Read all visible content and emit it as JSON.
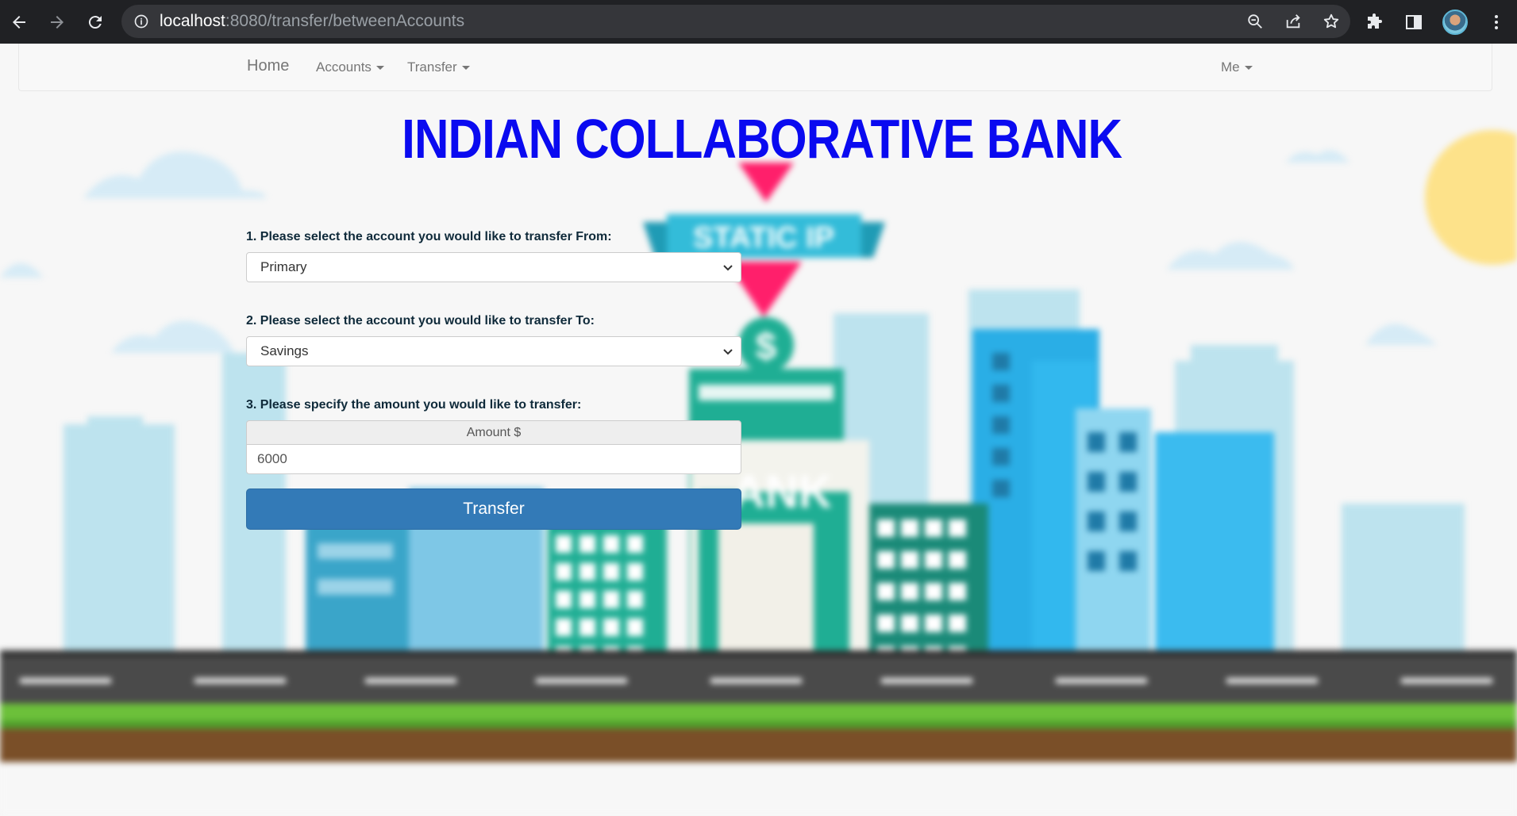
{
  "browser": {
    "url_host": "localhost",
    "url_rest": ":8080/transfer/betweenAccounts"
  },
  "navbar": {
    "home": "Home",
    "accounts": "Accounts",
    "transfer": "Transfer",
    "me": "Me"
  },
  "page_title": "INDIAN COLLABORATIVE BANK",
  "scene": {
    "sign_text": "STATIC IP",
    "dollar": "$",
    "bank_text": "ANK"
  },
  "form": {
    "from_label": "1. Please select the account you would like to transfer From:",
    "from_value": "Primary",
    "to_label": "2. Please select the account you would like to transfer To:",
    "to_value": "Savings",
    "amount_label": "3. Please specify the amount you would like to transfer:",
    "amount_addon": "Amount $",
    "amount_value": "6000",
    "submit": "Transfer"
  }
}
